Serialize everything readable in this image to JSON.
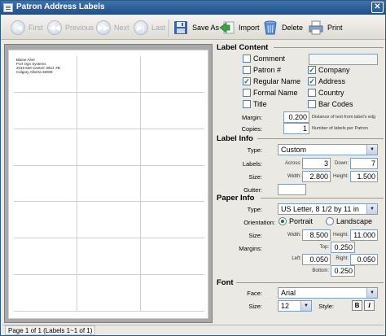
{
  "window": {
    "title": "Patron Address Labels",
    "close": "✕"
  },
  "toolbar": {
    "first": "First",
    "previous": "Previous",
    "next": "Next",
    "last": "Last",
    "save_as": "Save As",
    "import": "Import",
    "delete": "Delete",
    "print": "Print"
  },
  "preview": {
    "label_lines": [
      "Blaine Ahel",
      "Port Ogn Systems",
      "2019 628 Cantrel. Blvd. #B",
      "Calgary Alberta 36009"
    ]
  },
  "status": {
    "text": "Page 1 of 1 (Labels 1~1 of 1)"
  },
  "label_content": {
    "heading": "Label Content",
    "options": {
      "comment": {
        "label": "Comment",
        "checked": false
      },
      "patron_num": {
        "label": "Patron #",
        "checked": false
      },
      "company": {
        "label": "Company",
        "checked": true
      },
      "regular_name": {
        "label": "Regular Name",
        "checked": true
      },
      "address": {
        "label": "Address",
        "checked": true
      },
      "formal_name": {
        "label": "Formal Name",
        "checked": false
      },
      "country": {
        "label": "Country",
        "checked": false
      },
      "title": {
        "label": "Title",
        "checked": false
      },
      "bar_codes": {
        "label": "Bar Codes",
        "checked": false
      }
    },
    "comment_value": "",
    "margin_label": "Margin:",
    "margin_value": "0.200",
    "margin_hint": "Distance of text from label's edg",
    "copies_label": "Copies:",
    "copies_value": "1",
    "copies_hint": "Number of labels per Patron"
  },
  "label_info": {
    "heading": "Label Info",
    "type_label": "Type:",
    "type_value": "Custom",
    "labels_label": "Labels:",
    "across_label": "Across:",
    "across_value": "3",
    "down_label": "Down:",
    "down_value": "7",
    "size_label": "Size:",
    "width_label": "Width:",
    "width_value": "2.800",
    "height_label": "Height:",
    "height_value": "1.500",
    "gutter_label": "Gutter:",
    "gutter_value": ""
  },
  "paper_info": {
    "heading": "Paper Info",
    "type_label": "Type:",
    "type_value": "US Letter, 8 1/2 by 11 in",
    "orientation_label": "Orientation:",
    "portrait": "Portrait",
    "landscape": "Landscape",
    "orientation_selected": "Portrait",
    "size_label": "Size:",
    "width_label": "Width:",
    "width_value": "8.500",
    "height_label": "Height:",
    "height_value": "11.000",
    "margins_label": "Margins:",
    "top_label": "Top:",
    "top_value": "0.250",
    "left_label": "Left:",
    "left_value": "0.050",
    "right_label": "Right:",
    "right_value": "0.050",
    "bottom_label": "Bottom:",
    "bottom_value": "0.250"
  },
  "font": {
    "heading": "Font",
    "face_label": "Face:",
    "face_value": "Arial",
    "size_label": "Size:",
    "size_value": "12",
    "style_label": "Style:",
    "bold": "B",
    "italic": "I"
  },
  "colors": {
    "titlebar": "#2a5f99",
    "check": "#1f7a1f"
  }
}
